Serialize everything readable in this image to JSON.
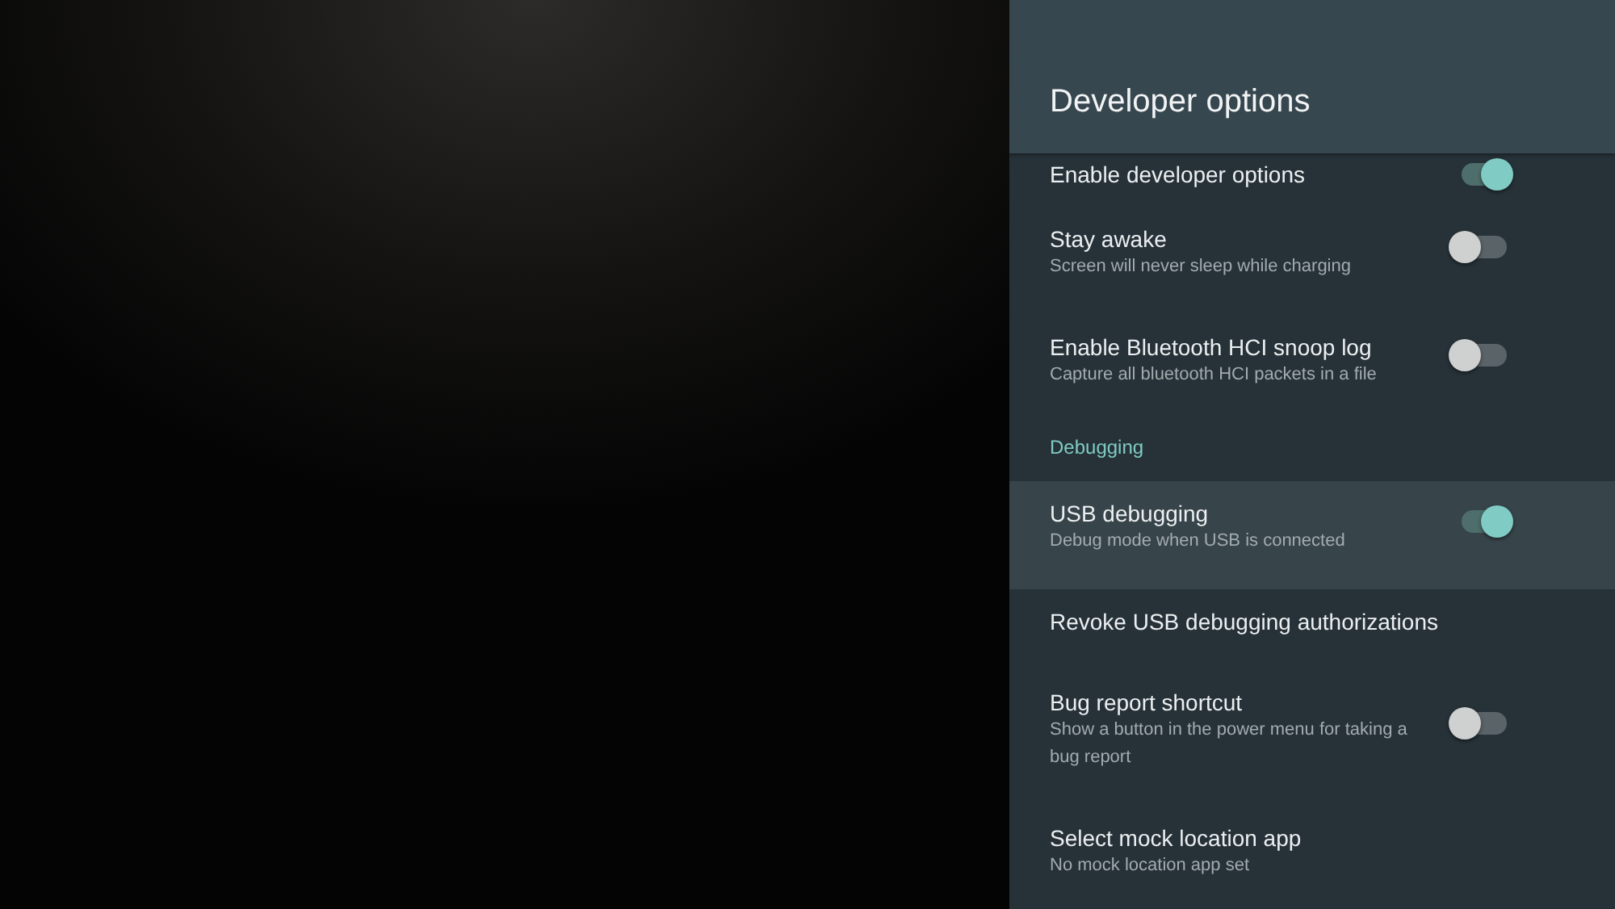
{
  "header": {
    "title": "Developer options"
  },
  "rows": [
    {
      "kind": "toggle",
      "title": "Enable developer options",
      "on": true,
      "selected": false
    },
    {
      "kind": "toggle",
      "title": "Stay awake",
      "subtitle": "Screen will never sleep while charging",
      "on": false,
      "selected": false
    },
    {
      "kind": "toggle",
      "title": "Enable Bluetooth HCI snoop log",
      "subtitle": "Capture all bluetooth HCI packets in a file",
      "on": false,
      "selected": false
    },
    {
      "kind": "category",
      "title": "Debugging"
    },
    {
      "kind": "toggle",
      "title": "USB debugging",
      "subtitle": "Debug mode when USB is connected",
      "on": true,
      "selected": true
    },
    {
      "kind": "action",
      "title": "Revoke USB debugging authorizations",
      "selected": false
    },
    {
      "kind": "toggle",
      "title": "Bug report shortcut",
      "subtitle": "Show a button in the power menu for taking a bug report",
      "on": false,
      "selected": false
    },
    {
      "kind": "action",
      "title": "Select mock location app",
      "subtitle": "No mock location app set",
      "selected": false
    }
  ]
}
